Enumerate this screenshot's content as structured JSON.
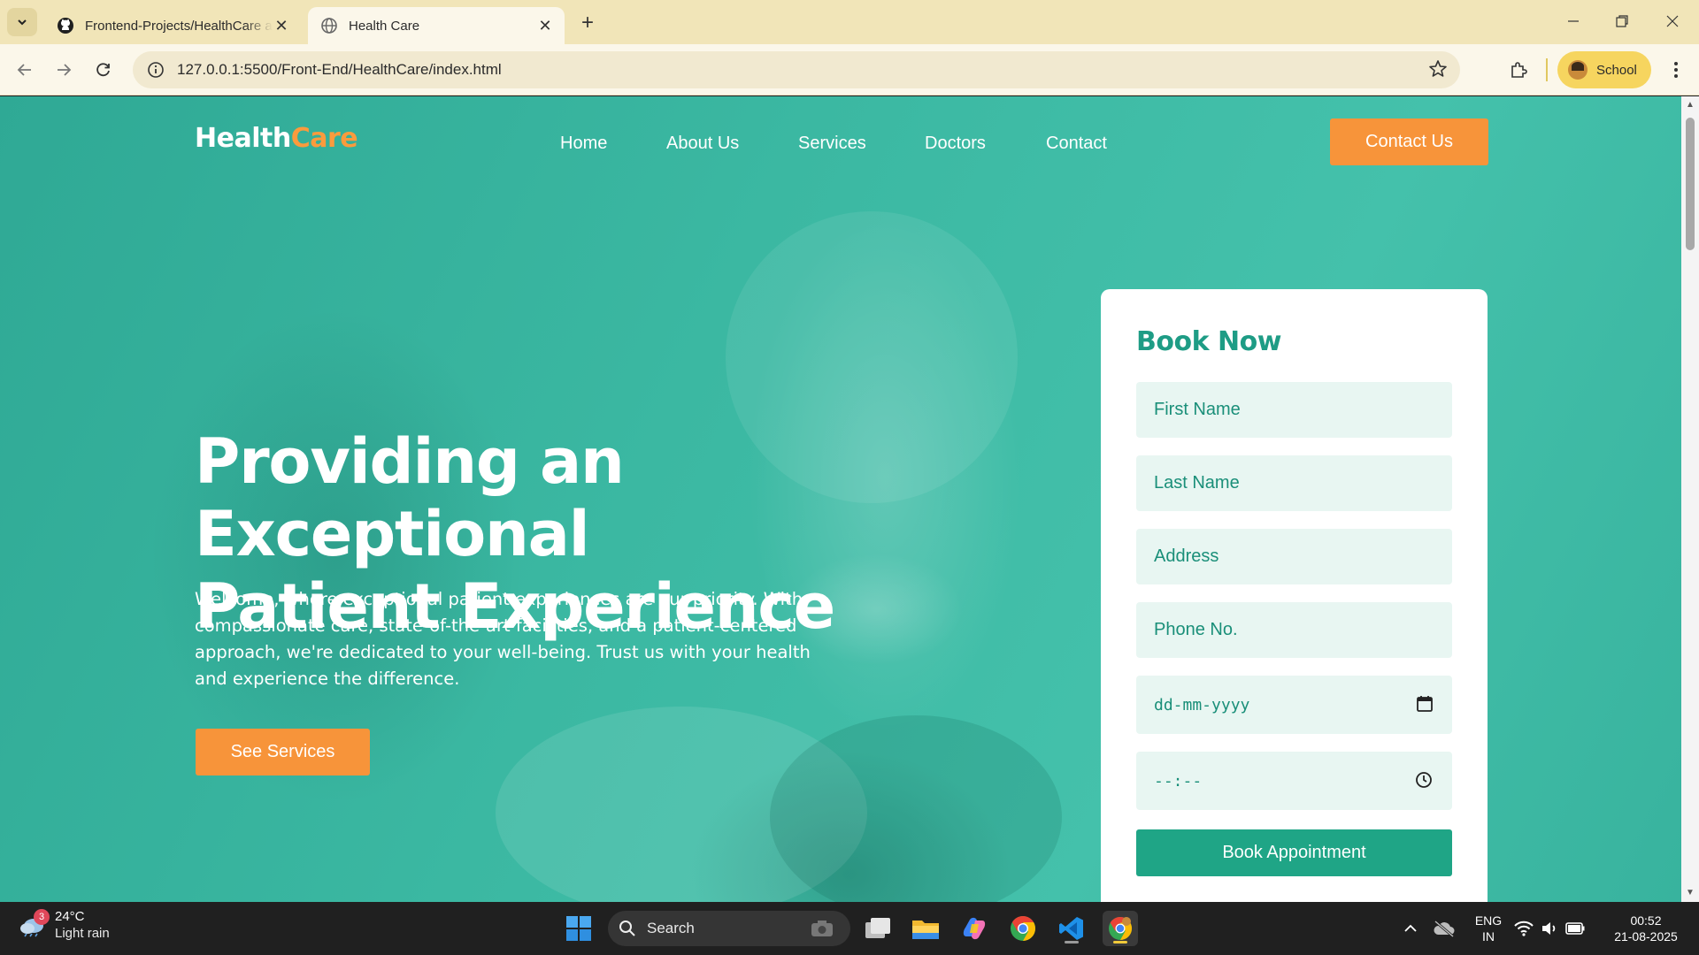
{
  "browser": {
    "tabs": [
      {
        "title": "Frontend-Projects/HealthCare at main",
        "icon": "github-icon"
      },
      {
        "title": "Health Care",
        "icon": "globe-icon"
      }
    ],
    "url": "127.0.0.1:5500/Front-End/HealthCare/index.html",
    "profile_name": "School"
  },
  "site": {
    "logo": {
      "part1": "Health",
      "part2": "Care"
    },
    "nav": [
      "Home",
      "About Us",
      "Services",
      "Doctors",
      "Contact"
    ],
    "contact_button": "Contact Us",
    "hero": {
      "headline_line1": "Providing an Exceptional",
      "headline_line2": "Patient Experience",
      "intro": "Welcome, where exceptional patient experiences are our priority. With compassionate care, state-of-the-art facilities, and a patient-centered approach, we're dedicated to your well-being. Trust us with your health and experience the difference.",
      "cta": "See Services"
    },
    "booking": {
      "title": "Book Now",
      "first_name_placeholder": "First Name",
      "last_name_placeholder": "Last Name",
      "address_placeholder": "Address",
      "phone_placeholder": "Phone No.",
      "date_placeholder": "dd-mm-yyyy",
      "time_placeholder": "--:--",
      "submit": "Book Appointment"
    },
    "colors": {
      "primary": "#1fa586",
      "accent": "#f7943a",
      "field_bg": "#e8f6f2"
    }
  },
  "taskbar": {
    "weather": {
      "temp": "24°C",
      "condition": "Light rain",
      "badge": "3"
    },
    "search_label": "Search",
    "lang_line1": "ENG",
    "lang_line2": "IN",
    "time": "00:52",
    "date": "21-08-2025"
  }
}
